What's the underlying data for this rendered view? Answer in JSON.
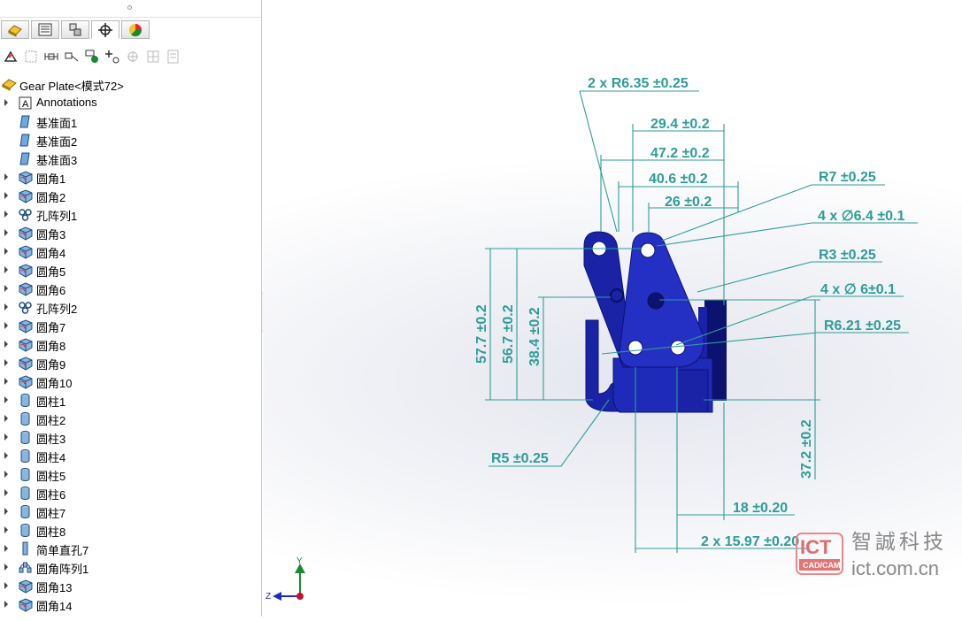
{
  "colors": {
    "dimension": "#2e9c98",
    "part": "#1a23a6",
    "part_dark": "#0c1270",
    "accent": "#e3342f"
  },
  "tree": {
    "root": {
      "label": "Gear Plate",
      "config": "<模式72>",
      "icon": "part-icon"
    },
    "items": [
      {
        "label": "Annotations",
        "icon": "annotations-icon",
        "expandable": true
      },
      {
        "label": "基准面1",
        "icon": "plane-icon",
        "expandable": false
      },
      {
        "label": "基准面2",
        "icon": "plane-icon",
        "expandable": false
      },
      {
        "label": "基准面3",
        "icon": "plane-icon",
        "expandable": false
      },
      {
        "label": "圆角1",
        "icon": "fillet-icon",
        "expandable": true
      },
      {
        "label": "圆角2",
        "icon": "fillet-icon",
        "expandable": true
      },
      {
        "label": "孔阵列1",
        "icon": "hole-pattern-icon",
        "expandable": true
      },
      {
        "label": "圆角3",
        "icon": "fillet-icon",
        "expandable": true
      },
      {
        "label": "圆角4",
        "icon": "fillet-icon",
        "expandable": true
      },
      {
        "label": "圆角5",
        "icon": "fillet-icon",
        "expandable": true
      },
      {
        "label": "圆角6",
        "icon": "fillet-icon",
        "expandable": true
      },
      {
        "label": "孔阵列2",
        "icon": "hole-pattern-icon",
        "expandable": true
      },
      {
        "label": "圆角7",
        "icon": "fillet-icon",
        "expandable": true
      },
      {
        "label": "圆角8",
        "icon": "fillet-icon",
        "expandable": true
      },
      {
        "label": "圆角9",
        "icon": "fillet-icon",
        "expandable": true
      },
      {
        "label": "圆角10",
        "icon": "fillet-icon",
        "expandable": true
      },
      {
        "label": "圆柱1",
        "icon": "cylinder-icon",
        "expandable": true
      },
      {
        "label": "圆柱2",
        "icon": "cylinder-icon",
        "expandable": true
      },
      {
        "label": "圆柱3",
        "icon": "cylinder-icon",
        "expandable": true
      },
      {
        "label": "圆柱4",
        "icon": "cylinder-icon",
        "expandable": true
      },
      {
        "label": "圆柱5",
        "icon": "cylinder-icon",
        "expandable": true
      },
      {
        "label": "圆柱6",
        "icon": "cylinder-icon",
        "expandable": true
      },
      {
        "label": "圆柱7",
        "icon": "cylinder-icon",
        "expandable": true
      },
      {
        "label": "圆柱8",
        "icon": "cylinder-icon",
        "expandable": true
      },
      {
        "label": "简单直孔7",
        "icon": "simple-hole-icon",
        "expandable": true
      },
      {
        "label": "圆角阵列1",
        "icon": "circular-pattern-icon",
        "expandable": true
      },
      {
        "label": "圆角13",
        "icon": "fillet-icon",
        "expandable": true
      },
      {
        "label": "圆角14",
        "icon": "fillet-icon",
        "expandable": true
      }
    ]
  },
  "dimensions": {
    "d1": "2 x R6.35 ±0.25",
    "d2": "29.4 ±0.2",
    "d3": "47.2 ±0.2",
    "d4": "40.6 ±0.2",
    "d5": "26 ±0.2",
    "d6": "R7 ±0.25",
    "d7": "4 x ∅6.4 ±0.1",
    "d8": "R3 ±0.25",
    "d9": "4 x ∅ 6±0.1",
    "d10": "R6.21 ±0.25",
    "d11": "57.7 ±0.2",
    "d12": "56.7 ±0.2",
    "d13": "38.4 ±0.2",
    "d14": "R5 ±0.25",
    "d15": "37.2 ±0.2",
    "d16": "18 ±0.20",
    "d17": "2 x 15.97 ±0.20"
  },
  "triad": {
    "y": "Y",
    "z": "Z"
  },
  "watermark": {
    "logo_main": "ICT",
    "logo_sub": "CAD/CAM",
    "cn": "智誠科技",
    "url": "ict.com.cn"
  }
}
